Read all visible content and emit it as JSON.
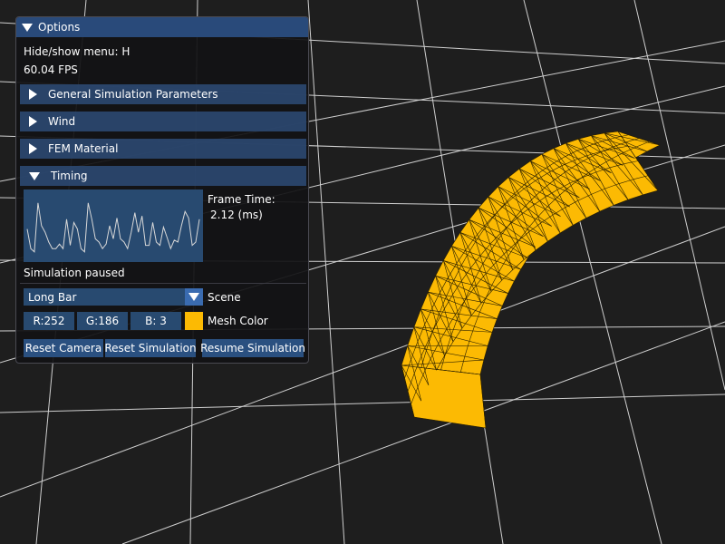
{
  "window_title": "Options",
  "hint": "Hide/show menu: H",
  "fps": "60.04 FPS",
  "sections": [
    {
      "label": "General Simulation Parameters",
      "expanded": false
    },
    {
      "label": "Wind",
      "expanded": false
    },
    {
      "label": "FEM Material",
      "expanded": false
    },
    {
      "label": "Timing",
      "expanded": true
    }
  ],
  "timing": {
    "frame_time_label": "Frame Time:",
    "frame_time_value": "2.12 (ms)",
    "plot_series": [
      0.45,
      0.15,
      0.1,
      0.85,
      0.5,
      0.4,
      0.25,
      0.15,
      0.15,
      0.22,
      0.15,
      0.6,
      0.2,
      0.55,
      0.45,
      0.15,
      0.1,
      0.85,
      0.6,
      0.3,
      0.25,
      0.15,
      0.22,
      0.5,
      0.3,
      0.62,
      0.3,
      0.25,
      0.15,
      0.4,
      0.7,
      0.4,
      0.65,
      0.2,
      0.2,
      0.55,
      0.25,
      0.2,
      0.48,
      0.32,
      0.15,
      0.28,
      0.25,
      0.5,
      0.72,
      0.62,
      0.2,
      0.25,
      0.6
    ]
  },
  "status": "Simulation paused",
  "scene": {
    "selected": "Long Bar",
    "label": "Scene"
  },
  "mesh_color": {
    "r": "R:252",
    "g": "G:186",
    "b": "B:  3",
    "label": "Mesh Color",
    "hex": "#fcba03"
  },
  "buttons": {
    "reset_camera": "Reset Camera",
    "reset_simulation": "Reset Simulation",
    "resume_simulation": "Resume Simulation"
  },
  "colors": {
    "background": "#1e1e1e",
    "grid": "#c8c8c8",
    "header": "#294a7a"
  }
}
